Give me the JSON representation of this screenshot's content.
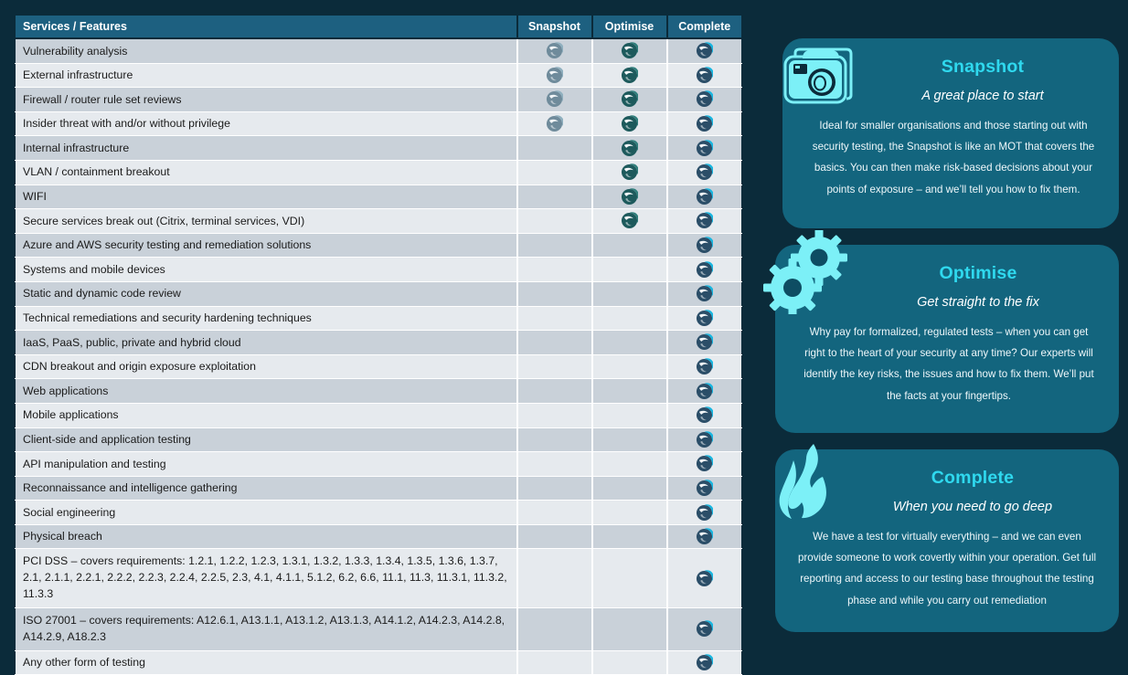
{
  "palette": {
    "page_background": "#0b2b3a",
    "table_header": "#1d6080",
    "row_odd": "#c9d1d9",
    "row_even": "#e6eaee",
    "card_background": "#13657e",
    "card_title_accent": "#2fd9ef",
    "icon_cyan": "#7cf0f7"
  },
  "table": {
    "headers": {
      "feature": "Services / Features",
      "snapshot": "Snapshot",
      "optimise": "Optimise",
      "complete": "Complete"
    },
    "rows": [
      {
        "feature": "Vulnerability analysis",
        "snapshot": true,
        "optimise": true,
        "complete": true
      },
      {
        "feature": "External infrastructure",
        "snapshot": true,
        "optimise": true,
        "complete": true
      },
      {
        "feature": "Firewall / router rule set reviews",
        "snapshot": true,
        "optimise": true,
        "complete": true
      },
      {
        "feature": "Insider threat with and/or without privilege",
        "snapshot": true,
        "optimise": true,
        "complete": true
      },
      {
        "feature": "Internal infrastructure",
        "snapshot": false,
        "optimise": true,
        "complete": true
      },
      {
        "feature": "VLAN / containment breakout",
        "snapshot": false,
        "optimise": true,
        "complete": true
      },
      {
        "feature": "WIFI",
        "snapshot": false,
        "optimise": true,
        "complete": true
      },
      {
        "feature": "Secure services break out (Citrix, terminal services, VDI)",
        "snapshot": false,
        "optimise": true,
        "complete": true
      },
      {
        "feature": "Azure and AWS security testing and remediation solutions",
        "snapshot": false,
        "optimise": false,
        "complete": true
      },
      {
        "feature": "Systems and mobile devices",
        "snapshot": false,
        "optimise": false,
        "complete": true
      },
      {
        "feature": "Static and dynamic code review",
        "snapshot": false,
        "optimise": false,
        "complete": true
      },
      {
        "feature": "Technical remediations and security hardening techniques",
        "snapshot": false,
        "optimise": false,
        "complete": true
      },
      {
        "feature": "IaaS, PaaS, public, private and hybrid cloud",
        "snapshot": false,
        "optimise": false,
        "complete": true
      },
      {
        "feature": "CDN breakout and origin exposure exploitation",
        "snapshot": false,
        "optimise": false,
        "complete": true
      },
      {
        "feature": "Web applications",
        "snapshot": false,
        "optimise": false,
        "complete": true
      },
      {
        "feature": "Mobile applications",
        "snapshot": false,
        "optimise": false,
        "complete": true
      },
      {
        "feature": "Client-side and application testing",
        "snapshot": false,
        "optimise": false,
        "complete": true
      },
      {
        "feature": "API manipulation and testing",
        "snapshot": false,
        "optimise": false,
        "complete": true
      },
      {
        "feature": "Reconnaissance and intelligence gathering",
        "snapshot": false,
        "optimise": false,
        "complete": true
      },
      {
        "feature": "Social engineering",
        "snapshot": false,
        "optimise": false,
        "complete": true
      },
      {
        "feature": "Physical breach",
        "snapshot": false,
        "optimise": false,
        "complete": true
      },
      {
        "feature": "PCI DSS – covers requirements: 1.2.1, 1.2.2, 1.2.3, 1.3.1, 1.3.2, 1.3.3, 1.3.4, 1.3.5, 1.3.6, 1.3.7, 2.1, 2.1.1, 2.2.1, 2.2.2, 2.2.3, 2.2.4, 2.2.5, 2.3, 4.1, 4.1.1, 5.1.2, 6.2, 6.6, 11.1, 11.3, 11.3.1, 11.3.2, 11.3.3",
        "snapshot": false,
        "optimise": false,
        "complete": true,
        "multiline": true
      },
      {
        "feature": "ISO 27001 – covers requirements: A12.6.1, A13.1.1, A13.1.2, A13.1.3, A14.1.2, A14.2.3, A14.2.8, A14.2.9, A18.2.3",
        "snapshot": false,
        "optimise": false,
        "complete": true,
        "multiline": true
      },
      {
        "feature": "Any other form of testing",
        "snapshot": false,
        "optimise": false,
        "complete": true
      }
    ]
  },
  "cards": [
    {
      "id": "snapshot",
      "icon": "camera-icon",
      "title": "Snapshot",
      "subtitle": "A great place to start",
      "body": "Ideal for smaller organisations and those starting out with security testing, the Snapshot is like an MOT that covers the basics. You can then make risk-based decisions about your points of exposure – and we’ll tell you how to fix them."
    },
    {
      "id": "optimise",
      "icon": "gears-icon",
      "title": "Optimise",
      "subtitle": "Get straight to the fix",
      "body": "Why pay for formalized, regulated tests – when you can get right to the heart of your security at any time? Our experts will identify the key risks, the issues and how to fix them. We’ll put the facts at your fingertips."
    },
    {
      "id": "complete",
      "icon": "flame-icon",
      "title": "Complete",
      "subtitle": "When you need to go deep",
      "body": "We have a test for virtually everything – and we can even provide someone to work covertly within your operation. Get full reporting and access to our testing base throughout the testing phase and while you carry out remediation"
    }
  ]
}
